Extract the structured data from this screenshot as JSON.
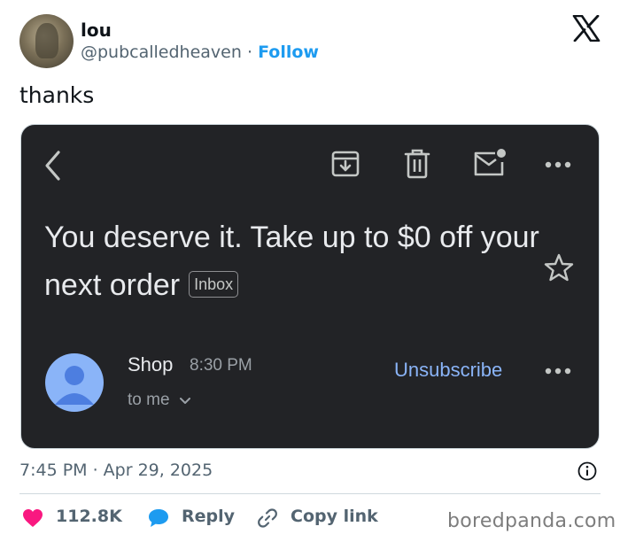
{
  "author": {
    "name": "lou",
    "handle": "@pubcalledheaven",
    "separator": "·",
    "follow_label": "Follow"
  },
  "tweet": {
    "text": "thanks",
    "timestamp": "7:45 PM · Apr 29, 2025",
    "likes": "112.8K",
    "reply_label": "Reply",
    "copy_link_label": "Copy link"
  },
  "email": {
    "subject": "You deserve it. Take up to $0 off your next order",
    "label_badge": "Inbox",
    "sender": "Shop",
    "time": "8:30 PM",
    "recipient": "to me",
    "unsubscribe_label": "Unsubscribe"
  },
  "watermark": "boredpanda.com",
  "colors": {
    "link_blue": "#1d9bf0",
    "like_red": "#f91880",
    "email_bg": "#222326",
    "unsubscribe_blue": "#8ab4f8"
  }
}
